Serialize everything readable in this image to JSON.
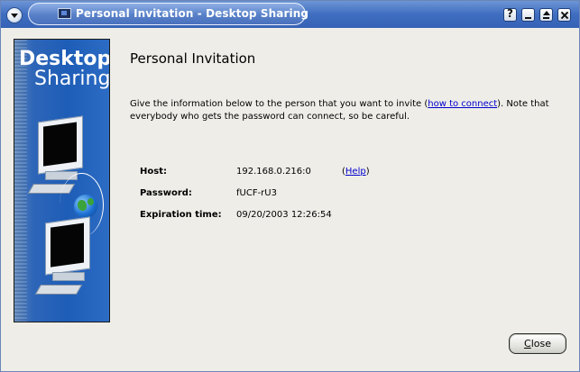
{
  "window": {
    "title": "Personal Invitation - Desktop Sharing",
    "icons": [
      "menu-icon",
      "app-icon",
      "help-icon",
      "minimize-icon",
      "maximize-icon",
      "close-icon"
    ]
  },
  "sidebar": {
    "title_line1": "Desktop",
    "title_line2": "Sharing"
  },
  "main": {
    "heading": "Personal Invitation",
    "desc_before": "Give the information below to the person that you want to invite (",
    "desc_link": "how to connect",
    "desc_after": "). Note that everybody who gets the password can connect, so be careful.",
    "fields": {
      "host_label": "Host:",
      "host_value": "192.168.0.216:0",
      "password_label": "Password:",
      "password_value": "fUCF-rU3",
      "expiration_label": "Expiration time:",
      "expiration_value": "09/20/2003 12:26:54"
    },
    "help_open": "(",
    "help_link": "Help",
    "help_close": ")"
  },
  "buttons": {
    "close_mnemonic": "C",
    "close_rest": "lose"
  },
  "colors": {
    "titlebar": "#3f6dc0",
    "background": "#eeede8",
    "link": "#0000cc",
    "sidebar": "#1e5db7"
  }
}
